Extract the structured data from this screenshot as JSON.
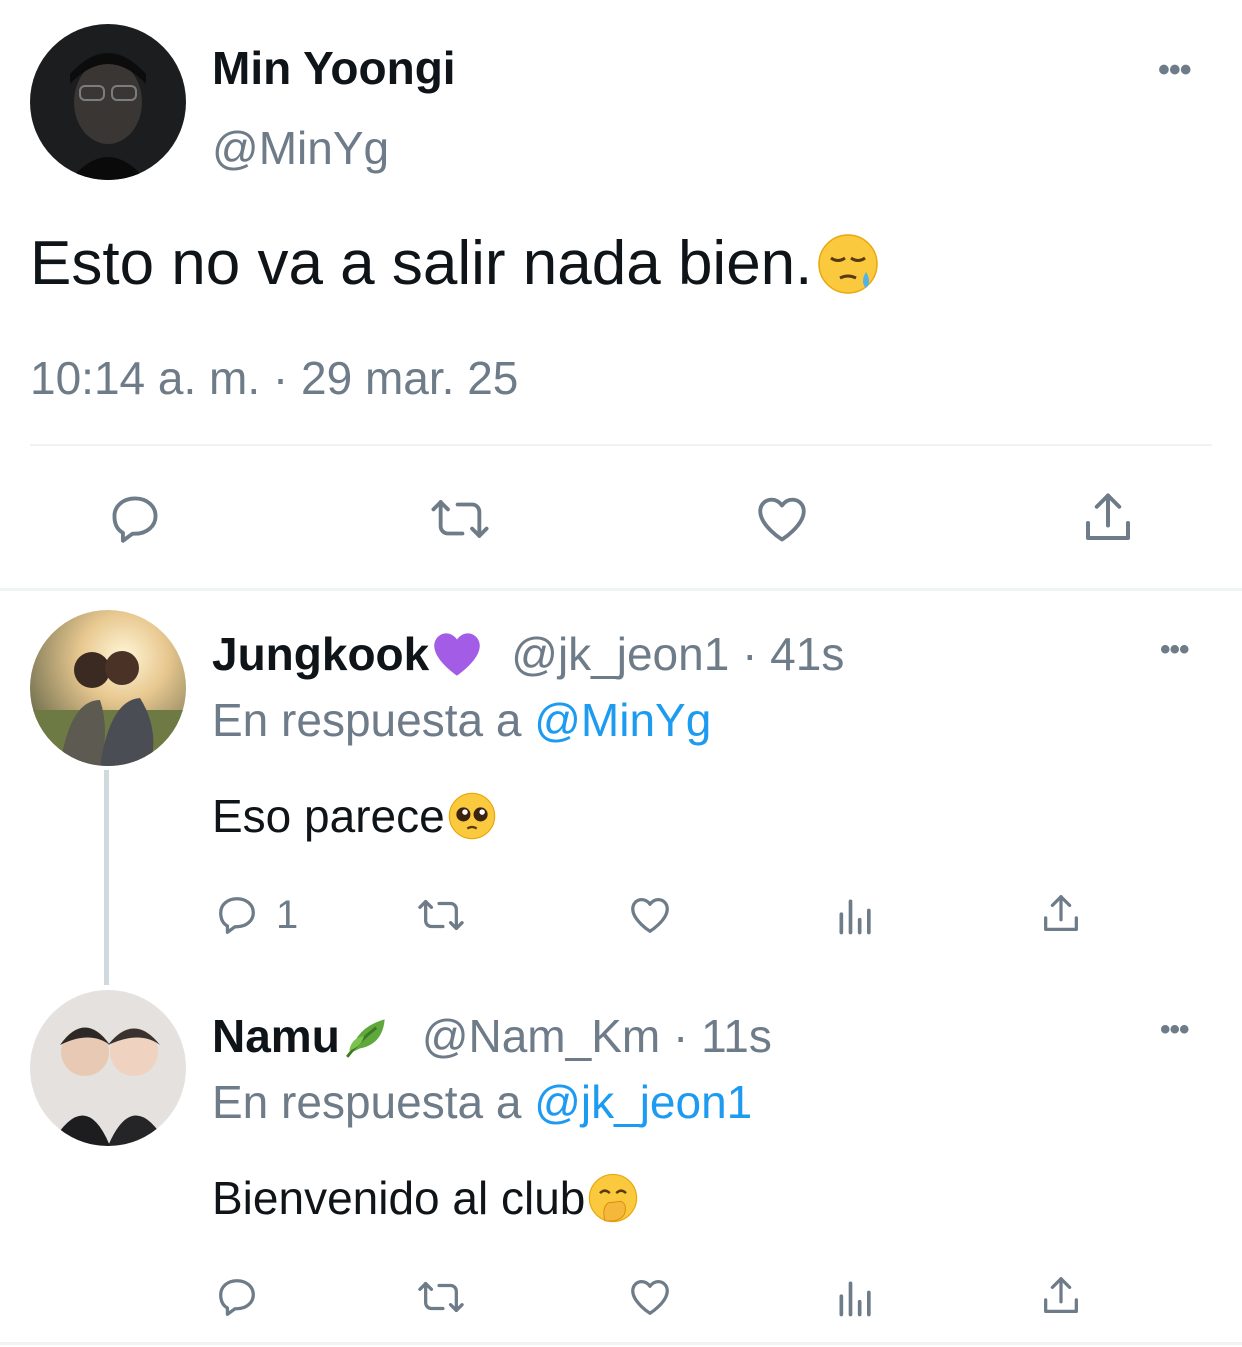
{
  "main_tweet": {
    "display_name": "Min Yoongi",
    "handle": "@MinYg",
    "text": "Esto no va a salir nada bien.",
    "emoji": "sleepy-face",
    "timestamp": "10:14 a. m. · 29 mar. 25"
  },
  "replies": [
    {
      "display_name": "Jungkook",
      "name_emoji": "purple-heart",
      "handle_time": "@jk_jeon1 · 41s",
      "reply_prefix": "En respuesta a",
      "reply_to": "@MinYg",
      "text": "Eso parece",
      "emoji": "pleading-face",
      "reply_count": "1"
    },
    {
      "display_name": "Namu",
      "name_emoji": "leaf",
      "handle_time": "@Nam_Km · 11s",
      "reply_prefix": "En respuesta a",
      "reply_to": "@jk_jeon1",
      "text": "Bienvenido al club",
      "emoji": "hand-over-mouth-face",
      "reply_count": ""
    }
  ],
  "colors": {
    "secondary_text": "#6e7b88",
    "link": "#1d9bf0",
    "divider": "#eff3f4"
  }
}
